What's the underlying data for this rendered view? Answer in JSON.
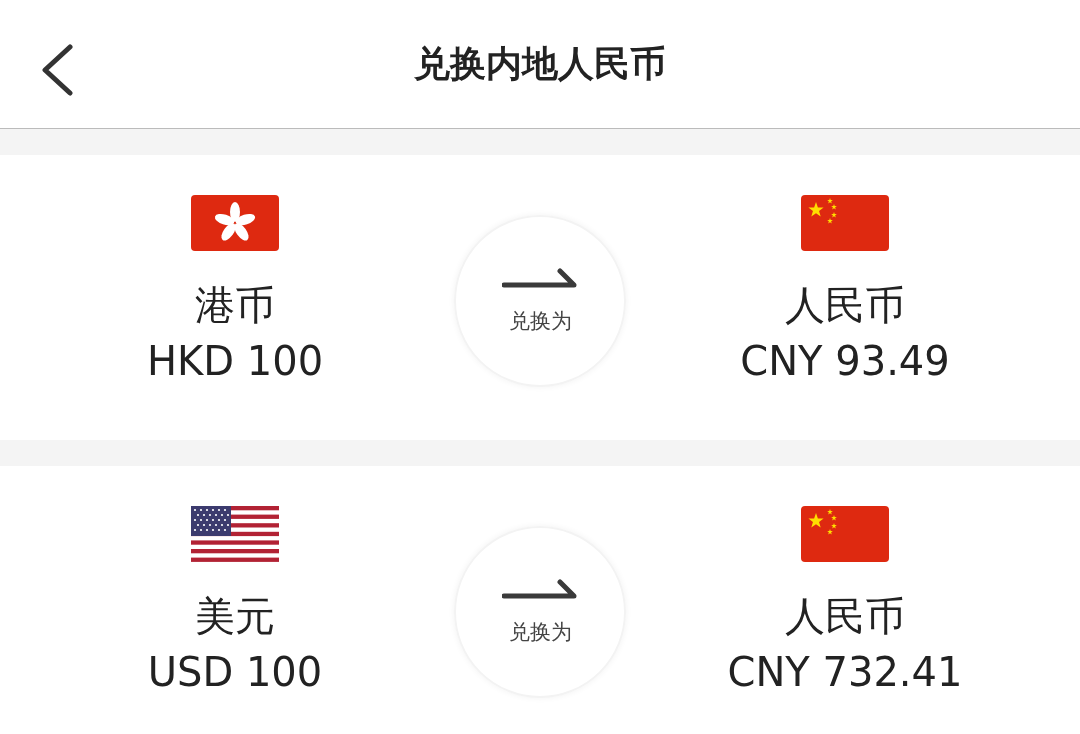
{
  "header": {
    "title": "兑换内地人民币"
  },
  "conversions": [
    {
      "from": {
        "kind": "hk",
        "name": "港币",
        "amount": "HKD 100"
      },
      "label": "兑换为",
      "to": {
        "kind": "cn",
        "name": "人民币",
        "amount": "CNY 93.49"
      }
    },
    {
      "from": {
        "kind": "us",
        "name": "美元",
        "amount": "USD 100"
      },
      "label": "兑换为",
      "to": {
        "kind": "cn",
        "name": "人民币",
        "amount": "CNY 732.41"
      }
    }
  ]
}
